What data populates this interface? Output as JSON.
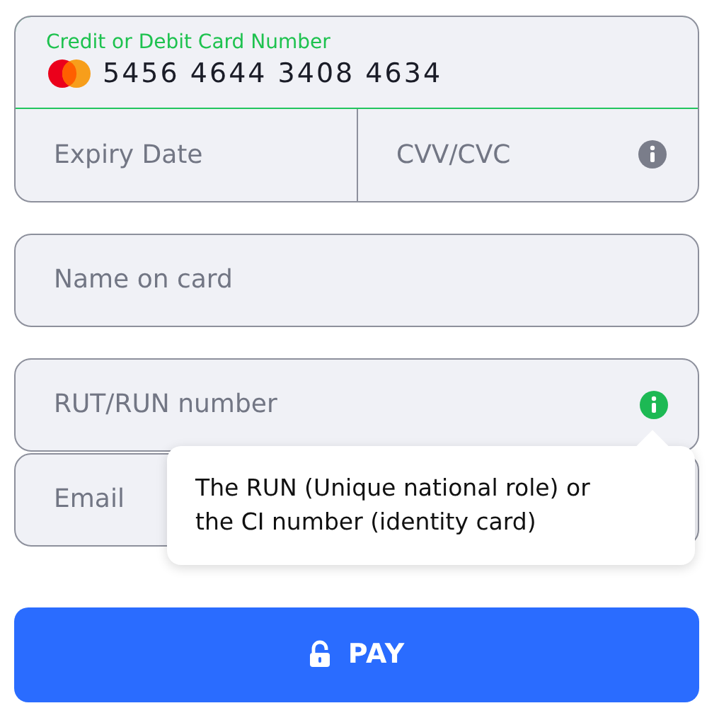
{
  "card_number": {
    "label": "Credit or Debit Card Number",
    "value": "5456 4644 3408 4634",
    "focused": true
  },
  "expiry": {
    "placeholder": "Expiry Date"
  },
  "cvv": {
    "placeholder": "CVV/CVC",
    "info": {
      "active": false
    }
  },
  "fields": [
    {
      "placeholder": "Name on card"
    },
    {
      "placeholder": "RUT/RUN number",
      "info": {
        "active": true
      },
      "tooltip": "The RUN (Unique national role) or the CI number (identity card)"
    },
    {
      "placeholder": "Email"
    }
  ],
  "pay_button": {
    "label": "PAY"
  }
}
